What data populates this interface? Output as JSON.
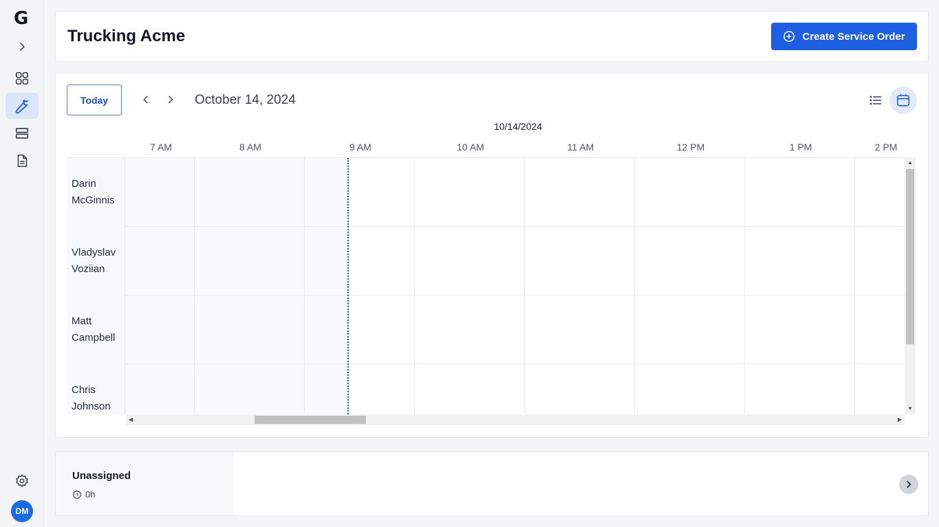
{
  "sidebar": {
    "logo": "G",
    "items": [
      {
        "name": "expand",
        "icon": "chevron-right-icon"
      },
      {
        "name": "dashboard",
        "icon": "grid-icon"
      },
      {
        "name": "service",
        "icon": "wrench-icon",
        "active": true
      },
      {
        "name": "list",
        "icon": "rows-icon"
      },
      {
        "name": "documents",
        "icon": "document-icon"
      }
    ],
    "settings_icon": "gear-icon",
    "avatar_initials": "DM"
  },
  "header": {
    "title": "Trucking Acme",
    "create_button_label": "Create Service Order",
    "create_button_icon": "plus-circle-icon"
  },
  "calendar": {
    "today_label": "Today",
    "date_title": "October 14, 2024",
    "day_label": "10/14/2024",
    "hours": [
      "7 AM",
      "8 AM",
      "9 AM",
      "10 AM",
      "11 AM",
      "12 PM",
      "1 PM",
      "2 PM"
    ],
    "resources": [
      {
        "first": "Darin",
        "last": "McGinnis"
      },
      {
        "first": "Vladyslav",
        "last": "Voziian"
      },
      {
        "first": "Matt",
        "last": "Campbell"
      },
      {
        "first": "Chris",
        "last": "Johnson"
      }
    ],
    "views": [
      "list-view-icon",
      "calendar-view-icon"
    ],
    "active_view": "calendar"
  },
  "unassigned": {
    "title": "Unassigned",
    "hours": "0h"
  },
  "colors": {
    "primary": "#1d5fe0",
    "accent_bg": "#dbe5f8",
    "now_line": "#1e4f8f"
  }
}
